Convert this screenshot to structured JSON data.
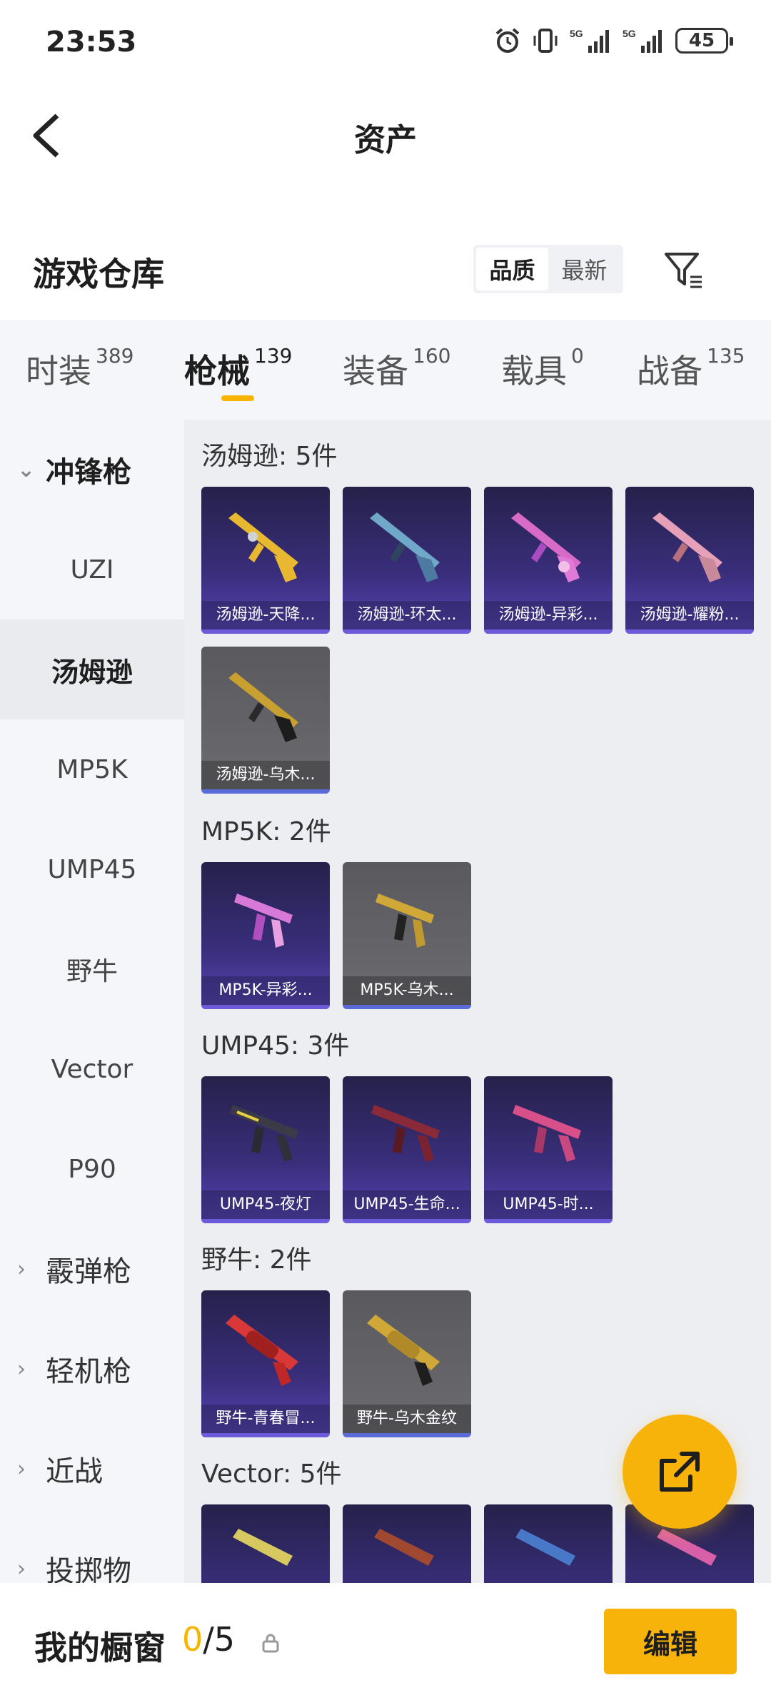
{
  "status": {
    "time": "23:53",
    "battery": "45"
  },
  "header": {
    "title": "资产"
  },
  "warehouse": {
    "title": "游戏仓库",
    "sort_quality": "品质",
    "sort_latest": "最新"
  },
  "tabs": [
    {
      "label": "时装",
      "count": "389"
    },
    {
      "label": "枪械",
      "count": "139"
    },
    {
      "label": "装备",
      "count": "160"
    },
    {
      "label": "载具",
      "count": "0"
    },
    {
      "label": "战备",
      "count": "135"
    }
  ],
  "sidebar": {
    "groups": [
      "冲锋枪",
      "霰弹枪",
      "轻机枪",
      "近战",
      "投掷物"
    ],
    "items": [
      "UZI",
      "汤姆逊",
      "MP5K",
      "UMP45",
      "野牛",
      "Vector",
      "P90"
    ]
  },
  "sections": [
    {
      "title": "汤姆逊: 5件",
      "items": [
        "汤姆逊-天降...",
        "汤姆逊-环太...",
        "汤姆逊-异彩...",
        "汤姆逊-耀粉...",
        "汤姆逊-乌木..."
      ]
    },
    {
      "title": "MP5K: 2件",
      "items": [
        "MP5K-异彩...",
        "MP5K-乌木..."
      ]
    },
    {
      "title": "UMP45: 3件",
      "items": [
        "UMP45-夜灯",
        "UMP45-生命...",
        "UMP45-时..."
      ]
    },
    {
      "title": "野牛: 2件",
      "items": [
        "野牛-青春冒...",
        "野牛-乌木金纹"
      ]
    },
    {
      "title": "Vector: 5件"
    }
  ],
  "showcase": {
    "label": "我的橱窗",
    "current": "0",
    "total": "/5",
    "edit": "编辑"
  },
  "colors": {
    "accent": "#f8b30b",
    "card_purple": "#3a2e7c",
    "card_gray": "#6c6c70"
  }
}
